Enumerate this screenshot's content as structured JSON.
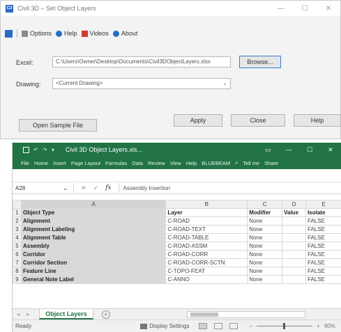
{
  "dialog": {
    "title": "Civil 3D – Set Object Layers",
    "app_icon_text": "C3",
    "window_controls": [
      "—",
      "☐",
      "✕"
    ],
    "menu": {
      "items": [
        {
          "label": "Options",
          "icon": "gear-icon"
        },
        {
          "label": "Help",
          "icon": "help-icon"
        },
        {
          "label": "Videos",
          "icon": "video-icon"
        },
        {
          "label": "About",
          "icon": "info-icon"
        }
      ]
    },
    "excel_label": "Excel:",
    "excel_path": "C:\\Users\\Owner\\Desktop\\Documents\\Civil3DObjectLayers.xlsx",
    "browse_label": "Browse...",
    "drawing_label": "Drawing:",
    "drawing_value": "<Current Drawing>",
    "open_sample_label": "Open Sample File",
    "apply_label": "Apply",
    "close_label": "Close",
    "help_label": "Help"
  },
  "excel": {
    "file_name": "Civil 3D Object Layers.xls...",
    "window_controls": [
      "▭",
      "—",
      "☐",
      "✕"
    ],
    "ribbon_tabs": [
      "File",
      "Home",
      "Insert",
      "Page Layout",
      "Formulas",
      "Data",
      "Review",
      "View",
      "Help",
      "BLUEBEAM",
      "Tell me",
      "Share"
    ],
    "name_box": "A28",
    "formula_content": "Assembly Insertion",
    "columns": [
      "",
      "A",
      "B",
      "C",
      "D",
      "E"
    ],
    "rows": [
      {
        "n": "1",
        "a": "Object Type",
        "b": "Layer",
        "c": "Modifier",
        "d": "Value",
        "e": "Isolate"
      },
      {
        "n": "2",
        "a": "Alignment",
        "b": "C-ROAD",
        "c": "None",
        "d": "",
        "e": "FALSE"
      },
      {
        "n": "3",
        "a": "Alignment Labeling",
        "b": "C-ROAD-TEXT",
        "c": "None",
        "d": "",
        "e": "FALSE"
      },
      {
        "n": "4",
        "a": "Alignment Table",
        "b": "C-ROAD-TABLE",
        "c": "None",
        "d": "",
        "e": "FALSE"
      },
      {
        "n": "5",
        "a": "Assembly",
        "b": "C-ROAD-ASSM",
        "c": "None",
        "d": "",
        "e": "FALSE"
      },
      {
        "n": "6",
        "a": "Corridor",
        "b": "C-ROAD-CORR",
        "c": "None",
        "d": "",
        "e": "FALSE"
      },
      {
        "n": "7",
        "a": "Corridor Section",
        "b": "C-ROAD-CORR-SCTN",
        "c": "None",
        "d": "",
        "e": "FALSE"
      },
      {
        "n": "8",
        "a": "Feature Line",
        "b": "C-TOPO-FEAT",
        "c": "None",
        "d": "",
        "e": "FALSE"
      },
      {
        "n": "9",
        "a": "General Note Label",
        "b": "C-ANNO",
        "c": "None",
        "d": "",
        "e": "FALSE"
      }
    ],
    "sheet_tab": "Object Layers",
    "status_ready": "Ready",
    "status_display": "Display Settings",
    "zoom_level": "90%"
  }
}
